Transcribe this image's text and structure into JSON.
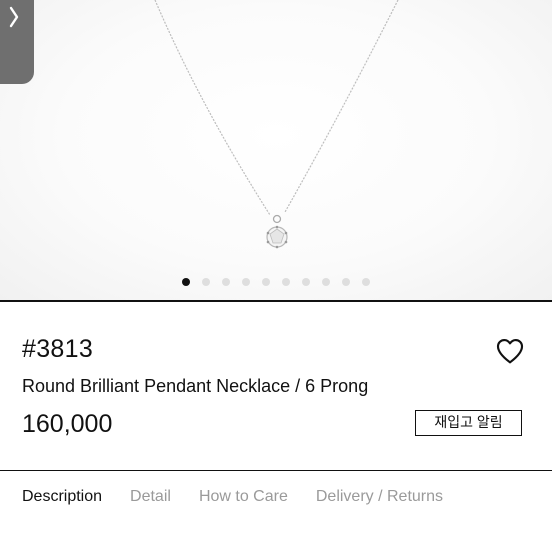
{
  "gallery": {
    "image_alt": "necklace-photo",
    "slide_count": 10,
    "active_index": 0
  },
  "product": {
    "sku": "#3813",
    "title": "Round Brilliant Pendant Necklace / 6 Prong",
    "price": "160,000",
    "restock_label": "재입고 알림"
  },
  "icons": {
    "prev": "chevron-left-icon",
    "wishlist": "heart-outline-icon"
  },
  "tabs": [
    {
      "label": "Description",
      "active": true
    },
    {
      "label": "Detail",
      "active": false
    },
    {
      "label": "How to Care",
      "active": false
    },
    {
      "label": "Delivery / Returns",
      "active": false
    }
  ],
  "colors": {
    "text": "#111111",
    "muted_tab": "#9a9a9a",
    "dot_inactive": "#dedede",
    "dot_active": "#111111",
    "prev_button": "#6f6f6f"
  }
}
